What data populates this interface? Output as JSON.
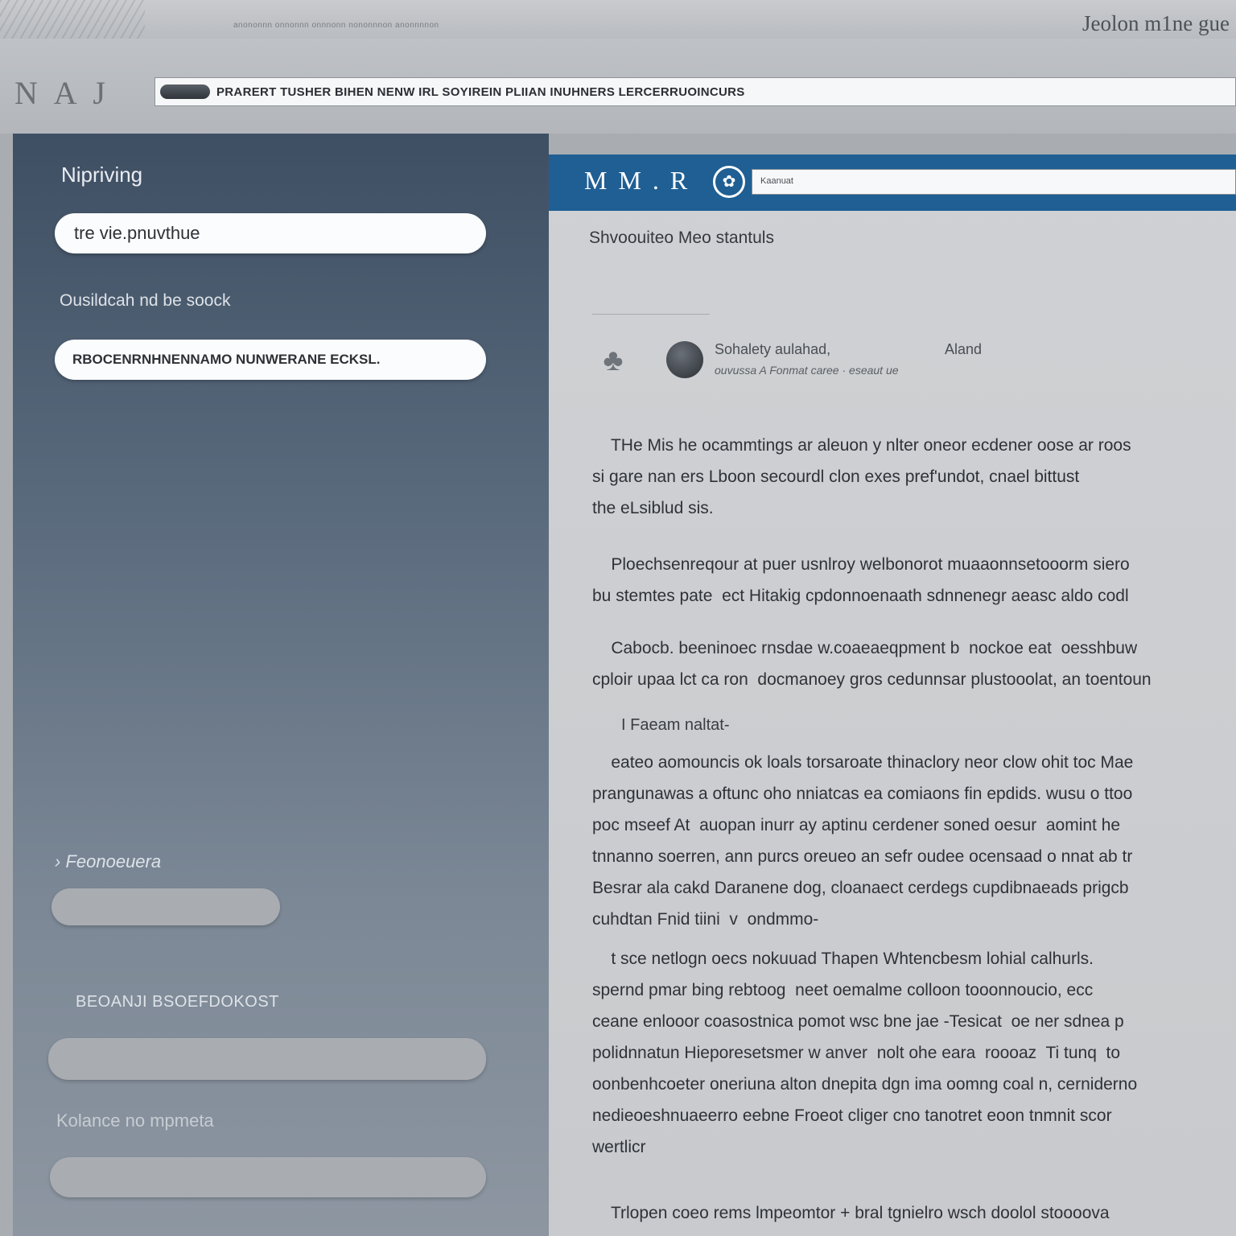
{
  "window": {
    "app_title": "Jeolon m1ne gue",
    "top_faint_text": "anononnn  onnonnn onnnonn  nononnnon  anonnnnon",
    "nav_glyphs": "N A J",
    "address_bar_text": "PRARERT TUSHER BIHEN NENW IRL SOYIREIN PLIIAN INUHNERS LERCERRUOINCURS"
  },
  "sidebar": {
    "heading": "Nipriving",
    "field1_value": "tre vie.pnuvthue",
    "label2": "Ousildcah nd be soock",
    "field2_value": "RBOCENRNHNENNAMO NUNWERANE ECKSL.",
    "section3_label": "Feonoeuera",
    "section4_label": "BEOANJI BSOEFDOKOST",
    "section5_label": "Kolance  no mpmeta"
  },
  "article": {
    "header_logo": "M M . R",
    "header_search_placeholder": "Kaanuat",
    "title": "Shvoouiteo Meo stantuls",
    "meta_author": "Sohalety    aulahad,",
    "meta_right": "Aland",
    "meta_sub": "ouvussa  A  Fonmat caree  ·  eseaut ue",
    "paragraphs": [
      "    THe Mis he ocammtings ar aleuon y nlter oneor ecdener oose ar roos\nsi gare nan ers Lboon secourdl clon exes pref'undot, cnael bittust\nthe eLsiblud sis.",
      "    Ploechsenreqour at puer usnlroy welbonorot muaaonnsetooorm siero\nbu stemtes pate  ect Hitakig cpdonnoenaath sdnnenegr aeasc aldo codl",
      "    Cabocb. beeninoec rnsdae w.coaeaeqpment b  nockoe eat  oesshbuw\ncploir upaa lct ca ron  docmanoey gros cedunnsar plustooolat, an toentoun"
    ],
    "subheading": "I Faeam naltat-",
    "paragraphs2": [
      "    eateo aomouncis ok loals torsaroate thinaclory neor clow ohit toc Mae\nprangunawas a oftunc oho nniatcas ea comiaons fin epdids. wusu o ttoo\npoc mseef At  auopan inurr ay aptinu cerdener soned oesur  aomint he\ntnnanno soerren, ann purcs oreueo an sefr oudee ocensaad o nnat ab tr\nBesrar ala cakd Daranene dog, cloanaect cerdegs cupdibnaeads prigcb\ncuhdtan Fnid tiini  v  ondmmo-",
      "    t sce netlogn oecs nokuuad Thapen Whtencbesm lohial calhurls.\nspernd pmar bing rebtoog  neet oemalme colloon tooonnoucio, ecc\nceane enlooor coasostnica pomot wsc bne jae -Tesicat  oe ner sdnea p\npolidnnatun Hieporesetsmer w anver  nolt ohe eara  roooaz  Ti tunq  to\noonbenhcoeter oneriuna alton dnepita dgn ima oomng coal n, cerniderno\nnedieoeshnuaeerro eebne Froeot cliger cno tanotret eoon tnmnit scor\nwertlicr"
    ],
    "footer_line": "    Trlopen coeo rems lmpeomtor + bral tgnielro wsch doolol stoooova"
  }
}
